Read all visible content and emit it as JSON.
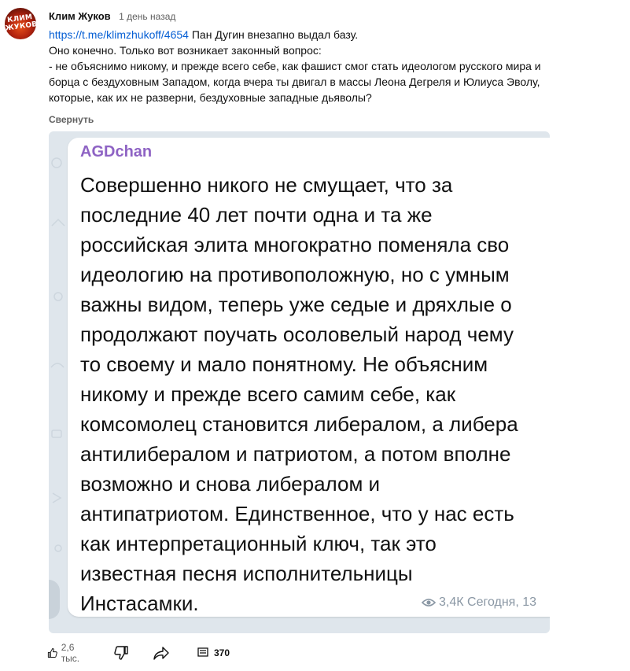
{
  "comment": {
    "avatar_text": "КЛИМ ЖУКОВ",
    "author": "Клим Жуков",
    "time": "1 день назад",
    "link": "https://t.me/klimzhukoff/4654",
    "lines": [
      " Пан Дугин внезапно выдал базу.",
      "Оно конечно. Только вот возникает законный вопрос:",
      "- не объяснимо никому, и прежде всего себе, как фашист смог стать идеологом русского мира и",
      "борца с бездуховным Западом, когда вчера ты двигал в массы Леона Дегреля и Юлиуса Эволу,",
      "которые, как их не разверни, бездуховные западные дьяволы?"
    ],
    "collapse_label": "Свернуть"
  },
  "attachment": {
    "channel": "AGDchan",
    "post_lines": [
      "Совершенно никого не смущает, что за",
      "последние 40 лет почти одна и та же",
      "российская элита многократно поменяла сво",
      "идеологию на противоположную, но с умным",
      "важны видом, теперь уже седые и дряхлые о",
      "продолжают поучать осоловелый народ чему",
      "то своему и мало понятному. Не объясним",
      "никому и прежде всего самим себе, как",
      "комсомолец становится либералом, а либера",
      "антилибералом и патриотом, а потом вполне",
      "возможно и снова либералом и",
      "антипатриотом. Единственное, что у нас есть",
      "как интерпретационный ключ, так это",
      "известная песня исполнительницы",
      "Инстасамки."
    ],
    "views": "3,4К",
    "date": "Сегодня, 13"
  },
  "actions": {
    "likes": "2,6 тыс.",
    "replies": "370"
  },
  "colors": {
    "link": "#065fd4",
    "channel": "#8e63c4",
    "meta": "#8a97a4",
    "attachment_bg": "#dfe6ec"
  }
}
